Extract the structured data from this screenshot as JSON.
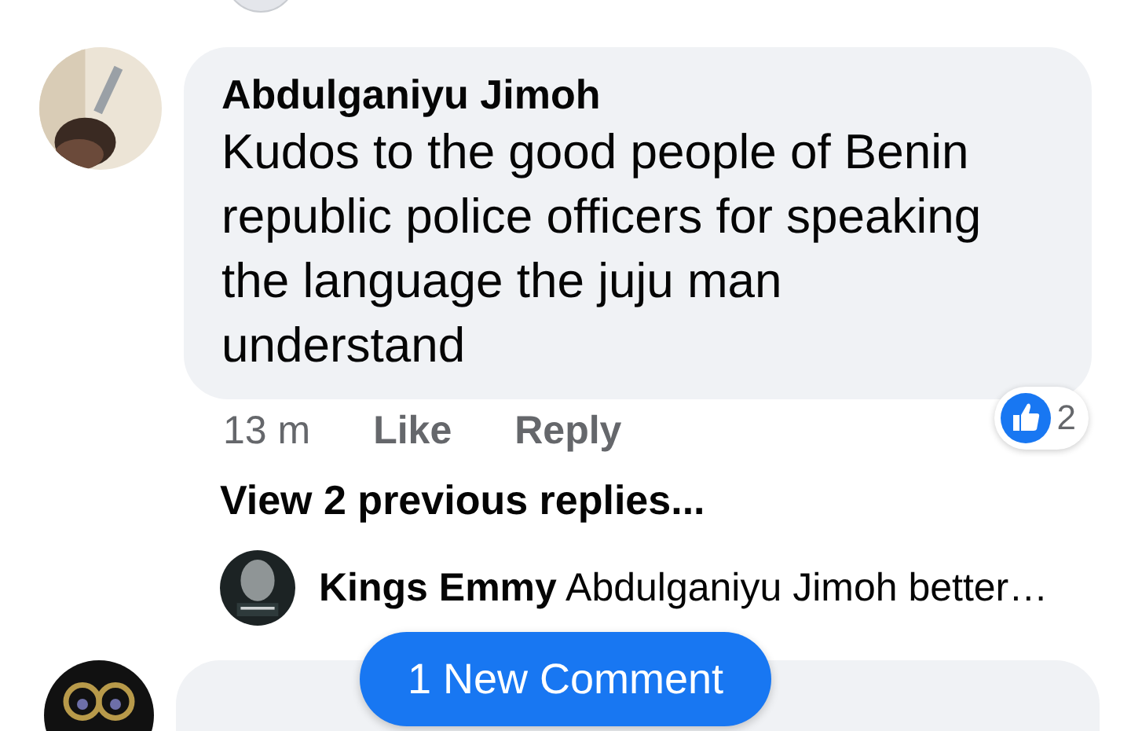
{
  "comment": {
    "author": "Abdulganiyu Jimoh",
    "text": "Kudos to the good people of Benin republic police officers for speaking the language the juju man understand",
    "time": "13 m",
    "actions": [
      "Like",
      "Reply"
    ],
    "reaction_count": "2"
  },
  "view_previous": "View 2 previous replies...",
  "reply": {
    "author": "Kings Emmy",
    "text": "Abdulganiyu Jimoh better…"
  },
  "new_comment_button": "1 New Comment"
}
